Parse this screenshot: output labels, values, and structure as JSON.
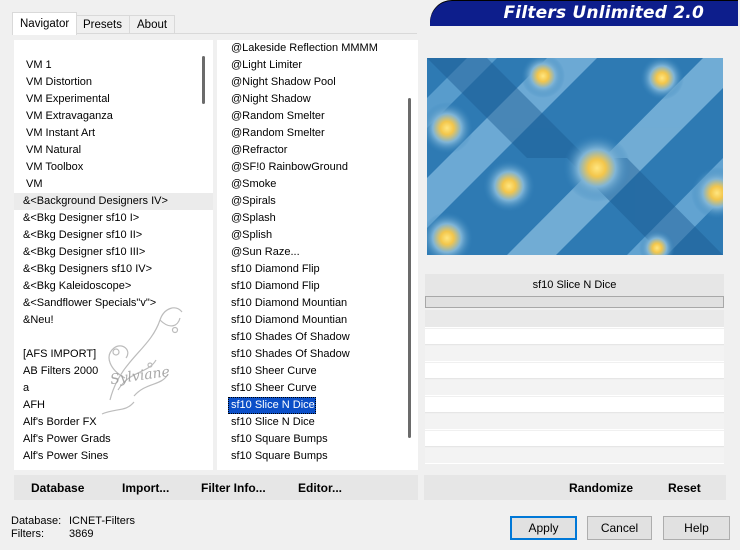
{
  "tabs": [
    "Navigator",
    "Presets",
    "About"
  ],
  "banner_title": "Filters Unlimited 2.0",
  "categories": [
    "VM 1",
    "VM Distortion",
    "VM Experimental",
    "VM Extravaganza",
    "VM Instant Art",
    "VM Natural",
    "VM Toolbox",
    "VM",
    "&<Background Designers IV>",
    "&<Bkg Designer sf10 I>",
    "&<Bkg Designer sf10 II>",
    "&<Bkg Designer sf10 III>",
    "&<Bkg Designers sf10 IV>",
    "&<Bkg Kaleidoscope>",
    "&<Sandflower Specials\"v\">",
    "&Neu!",
    "",
    "[AFS IMPORT]",
    "AB Filters 2000",
    "a",
    "AFH",
    "Alf's Border FX",
    "Alf's Power Grads",
    "Alf's Power Sines"
  ],
  "filters": [
    "@Lakeside Reflection MMMM",
    "@Light Limiter",
    "@Night Shadow Pool",
    "@Night Shadow",
    "@Random Smelter",
    "@Random Smelter",
    "@Refractor",
    "@SF!0 RainbowGround",
    "@Smoke",
    "@Spirals",
    "@Splash",
    "@Splish",
    "@Sun Raze...",
    "sf10 Diamond Flip",
    "sf10 Diamond Flip",
    "sf10 Diamond Mountian",
    "sf10 Diamond Mountian",
    "sf10 Shades Of Shadow",
    "sf10 Shades Of Shadow",
    "sf10 Sheer Curve",
    "sf10 Sheer Curve",
    "sf10 Slice N Dice",
    "sf10 Slice N Dice",
    "sf10 Square Bumps",
    "sf10 Square Bumps"
  ],
  "selected_filter_index": 21,
  "highlighted_category_index": 8,
  "watermark": "Sylviane",
  "current_filter": "sf10 Slice N Dice",
  "bottom_left": {
    "database": "Database",
    "import": "Import...",
    "filter_info": "Filter Info...",
    "editor": "Editor..."
  },
  "bottom_right": {
    "randomize": "Randomize",
    "reset": "Reset"
  },
  "status": {
    "database_label": "Database:",
    "database_value": "ICNET-Filters",
    "filters_label": "Filters:",
    "filters_value": "3869"
  },
  "buttons": {
    "apply": "Apply",
    "cancel": "Cancel",
    "help": "Help"
  },
  "colors": {
    "banner": "#0d1e8c",
    "selection": "#0b4fc8",
    "default_button_border": "#0078d7"
  }
}
